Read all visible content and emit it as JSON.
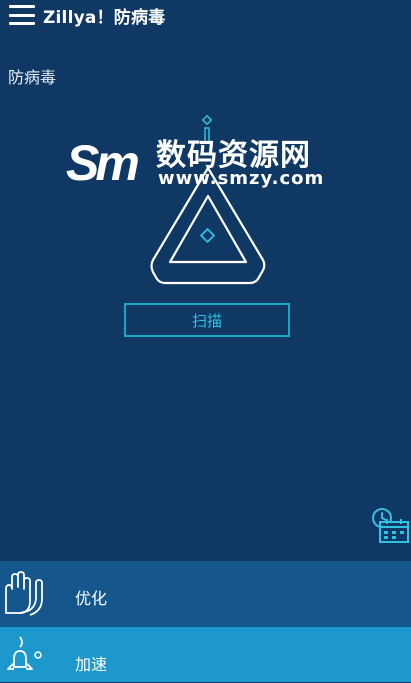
{
  "app_bar": {
    "title": "Zillya！防病毒"
  },
  "section": {
    "title": "防病毒"
  },
  "watermark": {
    "cn": "数码资源网",
    "url": "www.smzy.com"
  },
  "scan": {
    "label": "扫描"
  },
  "bottom_nav": {
    "items": [
      {
        "label": "优化",
        "icon": "gloves-icon"
      },
      {
        "label": "加速",
        "icon": "rocket-icon"
      }
    ]
  },
  "colors": {
    "background": "#0f3865",
    "accent": "#18a9c9",
    "optimize_row": "#15578c",
    "speed_row": "#1d98cc"
  }
}
